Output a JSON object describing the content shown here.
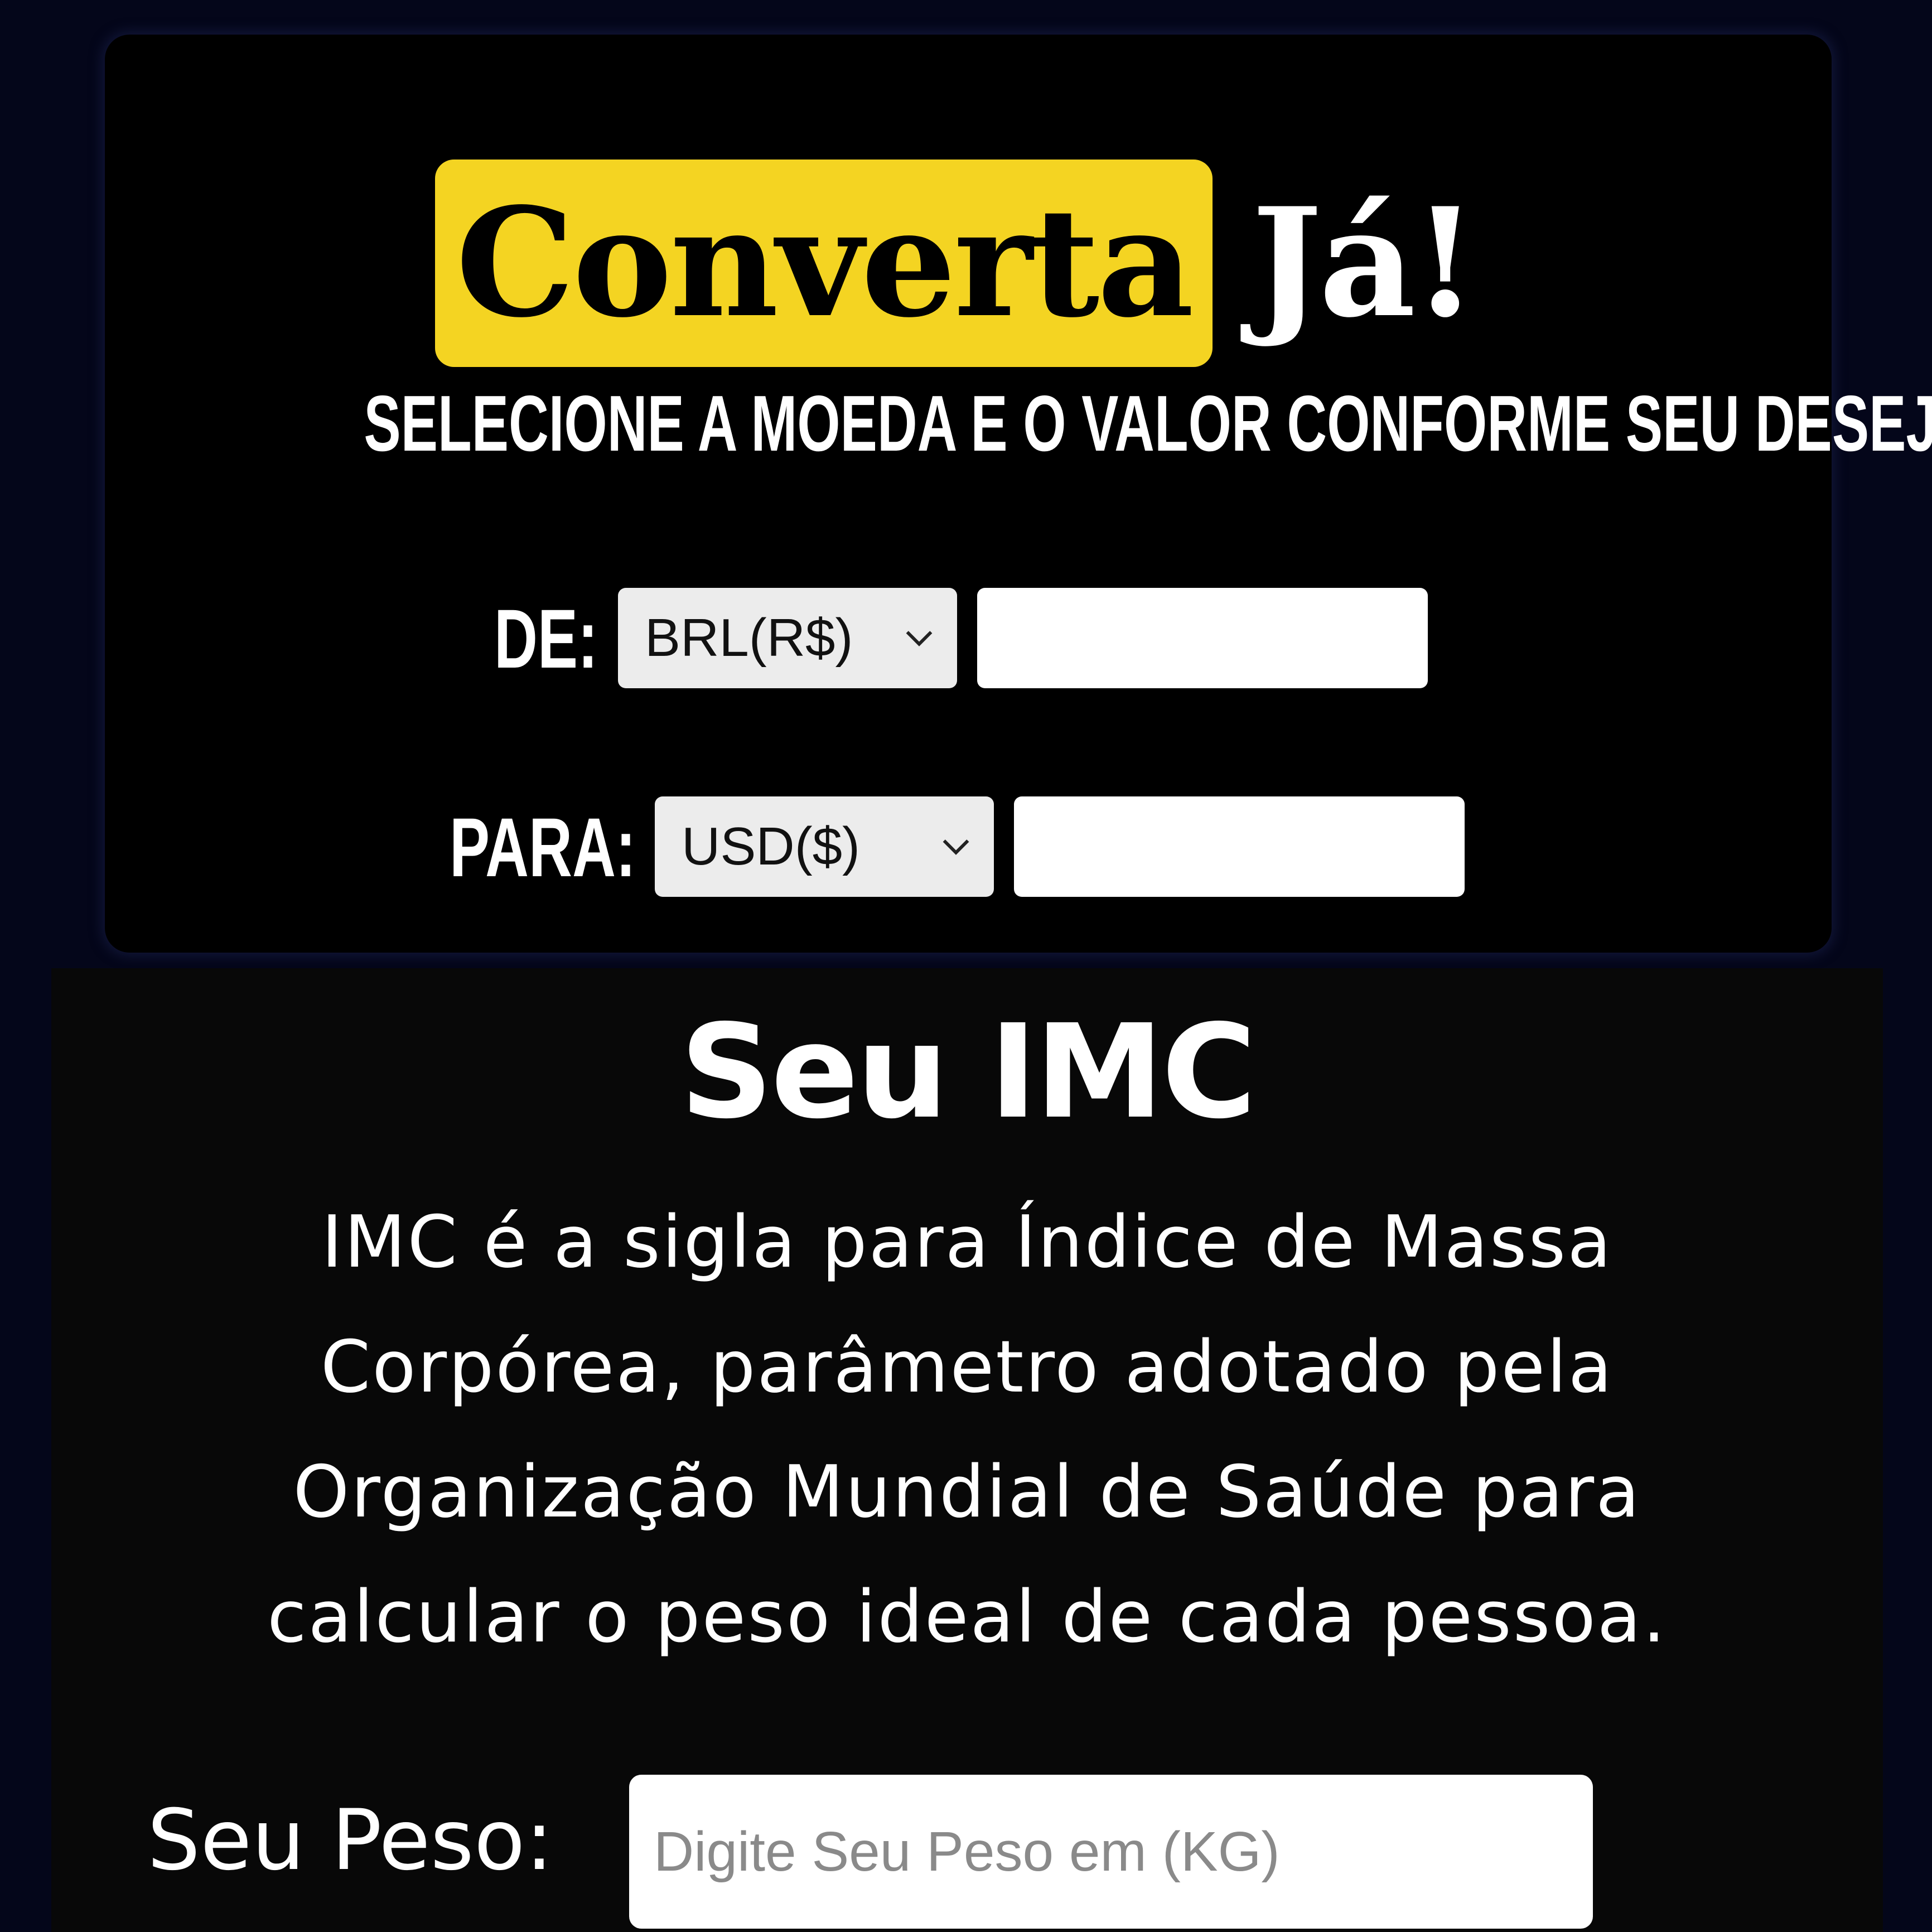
{
  "converter": {
    "brand_highlight": "Converta",
    "brand_rest": "Já!",
    "subtitle": "Selecione a moeda e o valor conforme seu desejo.",
    "from": {
      "label": "DE:",
      "currency": "BRL(R$)",
      "value": ""
    },
    "to": {
      "label": "PARA:",
      "currency": "USD($)",
      "value": ""
    }
  },
  "imc": {
    "title": "Seu IMC",
    "description": "IMC é a sigla para Índice de Massa Corpórea, parâmetro adotado pela Organização Mundial de Saúde para calcular o peso ideal de cada pessoa.",
    "weight_label": "Seu Peso:",
    "weight_placeholder": "Digite Seu Peso em (KG)"
  },
  "colors": {
    "page_background": "#04061a",
    "card_background": "#000000",
    "accent_yellow": "#f4d422",
    "imc_background": "#080808"
  },
  "icons": {
    "select_arrow": "chevron-down-icon"
  }
}
